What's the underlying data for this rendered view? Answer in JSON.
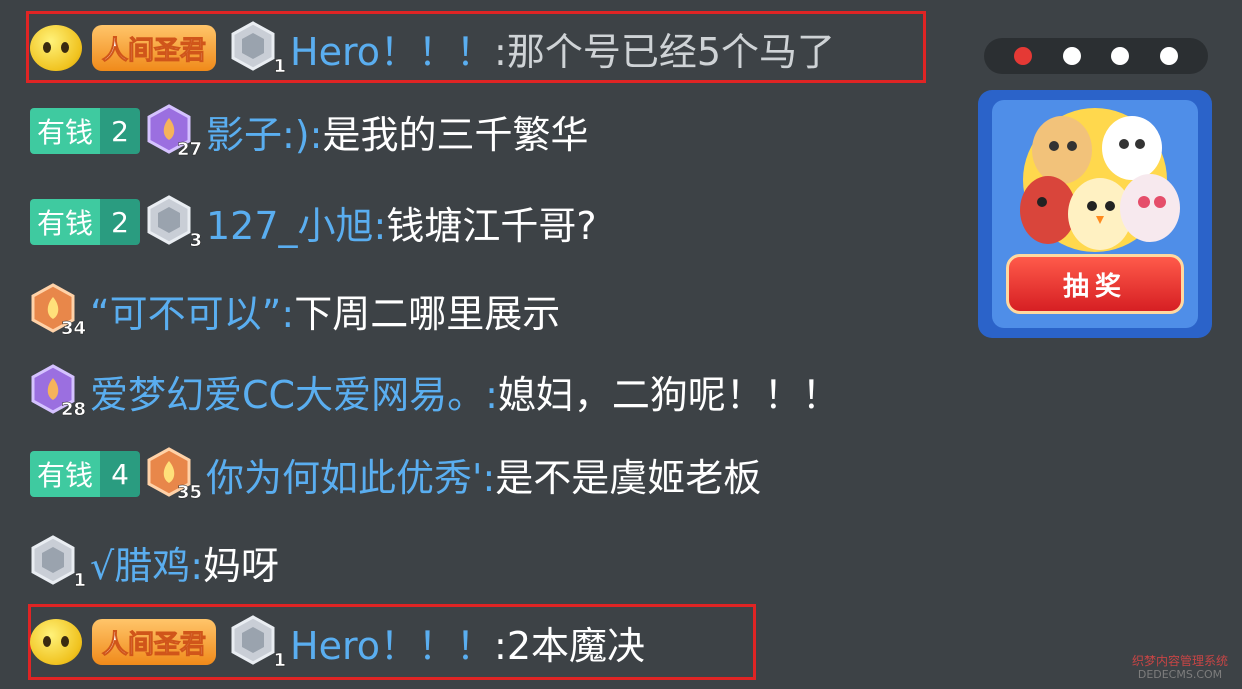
{
  "messages": [
    {
      "title_badge": "人间圣君",
      "level": "1",
      "name": "Hero！！！",
      "text": ":那个号已经5个马了"
    },
    {
      "rich_label": "有钱",
      "rich_level": "2",
      "level": "27",
      "name": "影子:):",
      "text": "是我的三千繁华"
    },
    {
      "rich_label": "有钱",
      "rich_level": "2",
      "level": "3",
      "name": "127_小旭:",
      "text": "钱塘江千哥?"
    },
    {
      "level": "34",
      "name": "“可不可以”:",
      "text": "下周二哪里展示"
    },
    {
      "level": "28",
      "name": "爱梦幻爱CC大爱网易。:",
      "text": "媳妇，二狗呢！！！"
    },
    {
      "rich_label": "有钱",
      "rich_level": "4",
      "level": "35",
      "name": "你为何如此优秀':",
      "text": "是不是虞姬老板"
    },
    {
      "level": "1",
      "name": "√腊鸡:",
      "text": "妈呀"
    },
    {
      "title_badge": "人间圣君",
      "level": "1",
      "name": "Hero！！！",
      "text": ":2本魔决"
    }
  ],
  "lottery": {
    "button_label": "抽奖"
  },
  "carousel": {
    "active_index": 0,
    "count": 4
  },
  "watermark": {
    "line1": "织梦内容管理系统",
    "line2": "DEDECMS.COM"
  },
  "colors": {
    "name": "#5aaef0",
    "highlight": "#e02424",
    "accent_red": "#e53935"
  }
}
